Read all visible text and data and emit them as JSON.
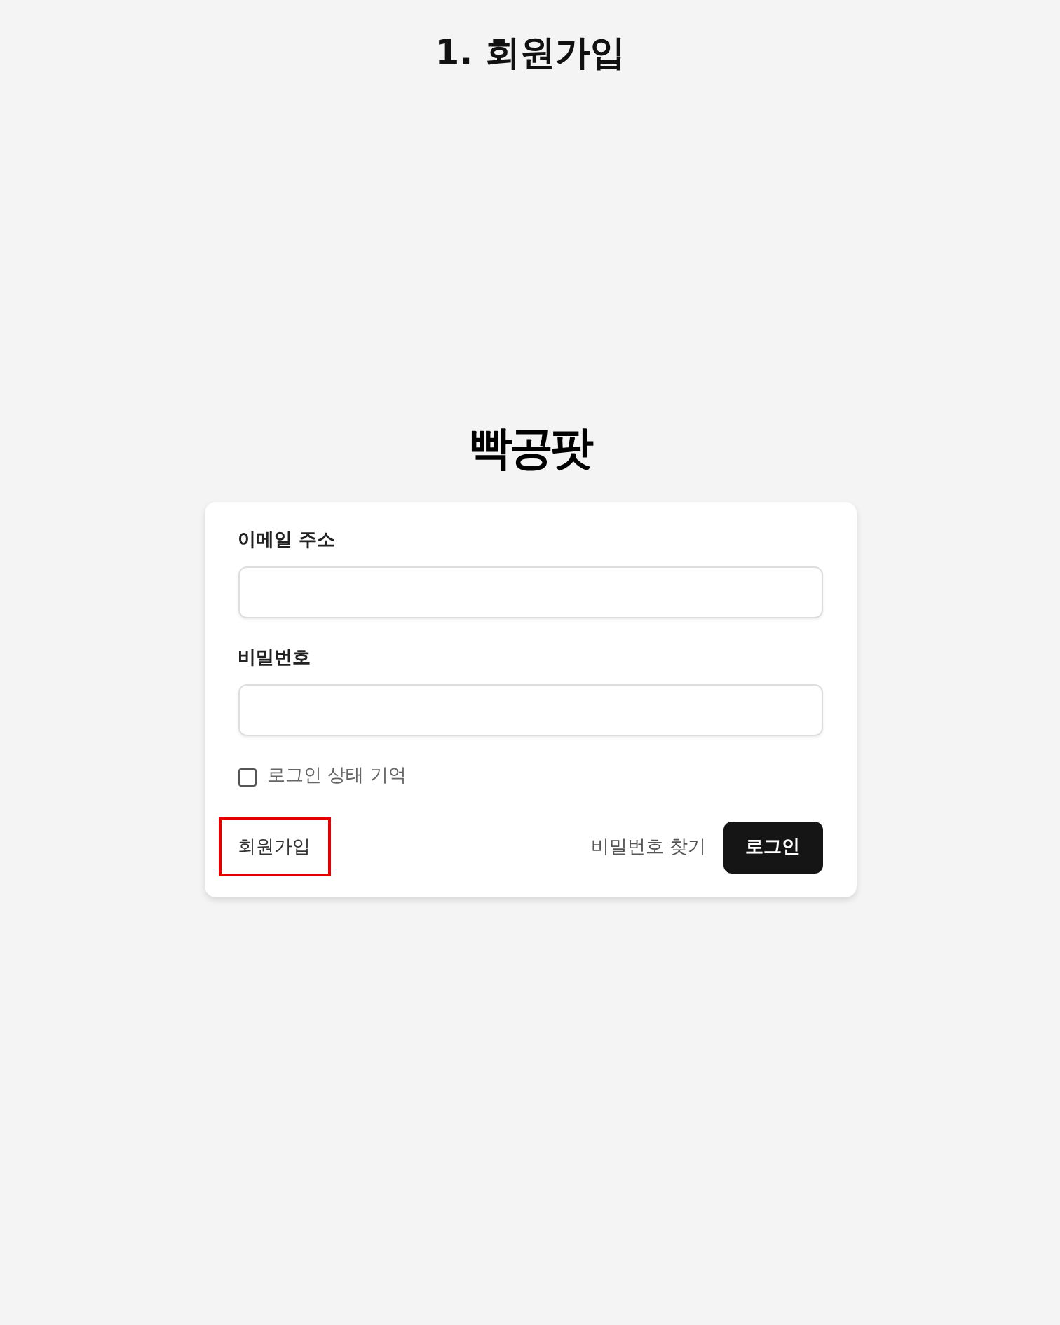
{
  "page_title": "1. 회원가입",
  "logo": "빡공팟",
  "form": {
    "fields": [
      {
        "label": "이메일 주소"
      },
      {
        "label": "비밀번호"
      }
    ],
    "remember": {
      "label": "로그인 상태 기억",
      "checked": false
    },
    "signup_link": {
      "label": "회원가입",
      "highlighted": true
    },
    "forgot_link": "비밀번호 찾기",
    "submit_button": "로그인"
  }
}
